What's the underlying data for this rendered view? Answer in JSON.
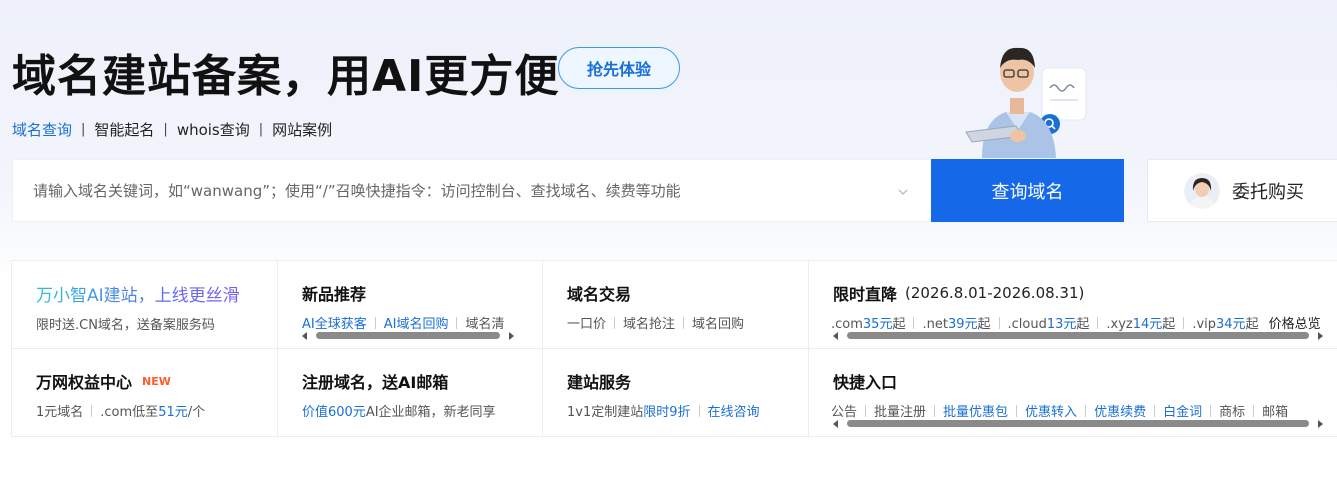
{
  "hero": {
    "title": "域名建站备案，用AI更方便",
    "try_button": "抢先体验",
    "links": [
      "域名查询",
      "智能起名",
      "whois查询",
      "网站案例"
    ]
  },
  "search": {
    "placeholder": "请输入域名关键词，如“wanwang”；使用“/”召唤快捷指令：访问控制台、查找域名、续费等功能",
    "button": "查询域名",
    "entrust": "委托购买"
  },
  "cards": {
    "c1": {
      "title": "万小智AI建站，上线更丝滑",
      "desc": "限时送.CN域名，送备案服务码"
    },
    "c2": {
      "title": "新品推荐",
      "items": [
        "AI全球获客",
        "AI域名回购",
        "域名清"
      ]
    },
    "c3": {
      "title": "域名交易",
      "items": [
        "一口价",
        "域名抢注",
        "域名回购"
      ]
    },
    "c4": {
      "title": "限时直降",
      "period": "(2026.8.01-2026.08.31)",
      "prices": [
        {
          "tld": ".com",
          "price": "35元",
          "suffix": "起"
        },
        {
          "tld": ".net",
          "price": "39元",
          "suffix": "起"
        },
        {
          "tld": ".cloud",
          "price": "13元",
          "suffix": "起"
        },
        {
          "tld": ".xyz",
          "price": "14元",
          "suffix": "起"
        },
        {
          "tld": ".vip",
          "price": "34元",
          "suffix": "起"
        }
      ],
      "tail": "价格总览"
    },
    "c5": {
      "title": "万网权益中心",
      "badge": "NEW",
      "item1": "1元域名",
      "item2a": ".com低至",
      "item2b": "51元",
      "item2c": "/个"
    },
    "c6": {
      "title": "注册域名，送AI邮箱",
      "desc_a": "价值600元",
      "desc_b": "AI企业邮箱，新老同享"
    },
    "c7": {
      "title": "建站服务",
      "item_a": "1v1定制建站",
      "item_b": "限时9折",
      "item_c": "在线咨询"
    },
    "c8": {
      "title": "快捷入口",
      "items": [
        "公告",
        "批量注册",
        "批量优惠包",
        "优惠转入",
        "优惠续费",
        "白金词",
        "商标",
        "邮箱"
      ]
    }
  },
  "colors": {
    "accent": "#1568e8",
    "link": "#1a6fd6",
    "new_badge": "#ff5a2c"
  }
}
